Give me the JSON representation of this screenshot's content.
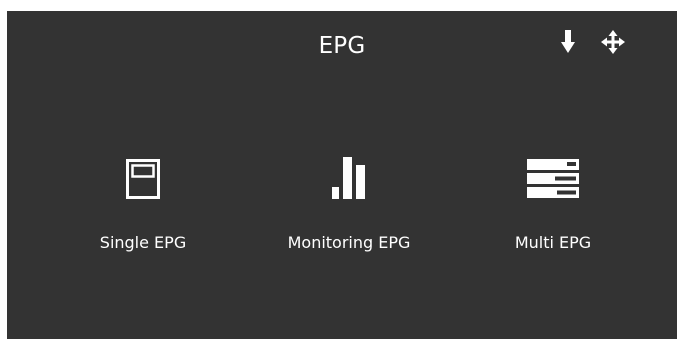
{
  "header": {
    "title": "EPG",
    "icons": {
      "download": "arrow-down-icon",
      "move": "move-arrows-icon"
    }
  },
  "options": [
    {
      "label": "Single EPG",
      "icon": "single-window-icon"
    },
    {
      "label": "Monitoring EPG",
      "icon": "bar-chart-icon"
    },
    {
      "label": "Multi EPG",
      "icon": "stacked-list-icon"
    }
  ],
  "colors": {
    "background": "#333333",
    "foreground": "#ffffff",
    "page": "#ffffff"
  }
}
